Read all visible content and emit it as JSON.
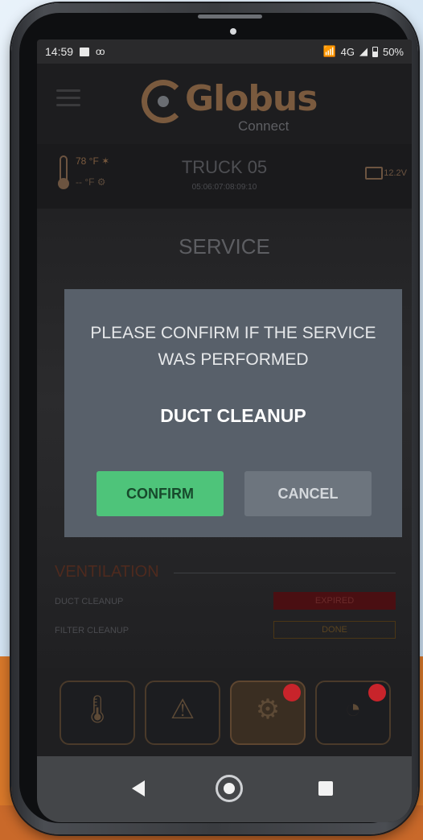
{
  "status_bar": {
    "time": "14:59",
    "network": "4G",
    "battery": "50%"
  },
  "app": {
    "logo_text": "Globus",
    "logo_sub": "Connect"
  },
  "info": {
    "temp_inside": "78 °F ✶",
    "temp_outside": "-- °F ⚙",
    "truck_name": "TRUCK 05",
    "truck_time": "05:06:07:08:09:10",
    "voltage": "12.2V"
  },
  "service": {
    "title": "SERVICE",
    "section": "VENTILATION",
    "items": [
      {
        "label": "DUCT CLEANUP",
        "status": "EXPIRED"
      },
      {
        "label": "FILTER CLEANUP",
        "status": "DONE"
      }
    ]
  },
  "dialog": {
    "message": "PLEASE CONFIRM IF THE SERVICE WAS PERFORMED",
    "service_name": "DUCT CLEANUP",
    "confirm_label": "CONFIRM",
    "cancel_label": "CANCEL"
  },
  "tabs": [
    {
      "name": "climate",
      "icon": "thermometer-icon",
      "glyph": "🌡",
      "badge": false
    },
    {
      "name": "alerts",
      "icon": "warning-icon",
      "glyph": "⚠",
      "badge": false
    },
    {
      "name": "service",
      "icon": "service-icon",
      "glyph": "⚙",
      "badge": true
    },
    {
      "name": "gauge",
      "icon": "gauge-icon",
      "glyph": "◔",
      "badge": true
    }
  ],
  "colors": {
    "confirm": "#4ec47a",
    "cancel": "#6d757e",
    "dialog": "#58606a",
    "accent": "#7a5a3e",
    "badge": "#c8242b"
  }
}
